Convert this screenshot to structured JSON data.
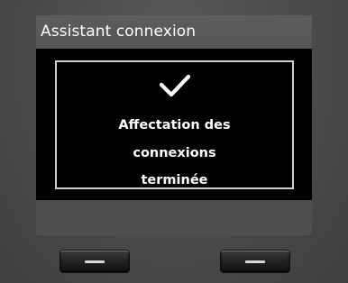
{
  "header": {
    "title": "Assistant connexion"
  },
  "dialog": {
    "icon": "checkmark-icon",
    "message_lines": [
      "Affectation des",
      "connexions",
      "terminée"
    ]
  },
  "softkeys": [
    {
      "icon": "dash-icon"
    },
    {
      "icon": "dash-icon"
    }
  ],
  "colors": {
    "title_bar": "#5a5a5a",
    "content_background": "#000000",
    "dialog_border": "#cfcfcf",
    "text": "#ffffff"
  }
}
